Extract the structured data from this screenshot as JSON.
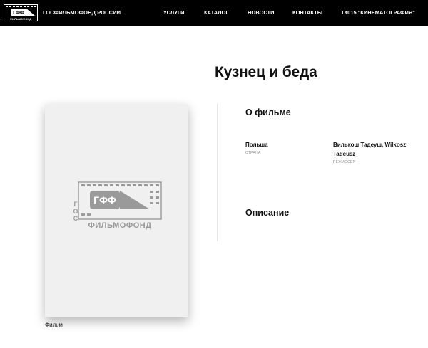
{
  "header": {
    "brand": "ГОСФИЛЬМОФОНД РОССИИ",
    "logo_text": "ГФФ",
    "logo_caption": "ФИЛЬМОФОНД",
    "nav": [
      {
        "label": "УСЛУГИ"
      },
      {
        "label": "КАТАЛОГ"
      },
      {
        "label": "НОВОСТИ"
      },
      {
        "label": "КОНТАКТЫ"
      },
      {
        "label": "ТК015 \"КИНЕМАТОГРАФИЯ\""
      }
    ]
  },
  "page": {
    "title": "Кузнец и беда"
  },
  "poster": {
    "logo_text": "ГФФ",
    "logo_side": "ГОС",
    "logo_caption": "ФИЛЬМОФОНД",
    "caption": "Фильм"
  },
  "about": {
    "heading": "О фильме",
    "country_value": "Польша",
    "country_label": "СТРАНА",
    "director_value_line1": "Вилькош Тадеуш, Wilkosz",
    "director_value_line2": "Tadeusz",
    "director_label": "РЕЖИССЕР"
  },
  "description": {
    "heading": "Описание"
  },
  "colors": {
    "header_bg": "#000000",
    "page_bg": "#ffffff",
    "poster_bg": "#f0f0f0",
    "logo_gray": "#9a9a9a"
  }
}
